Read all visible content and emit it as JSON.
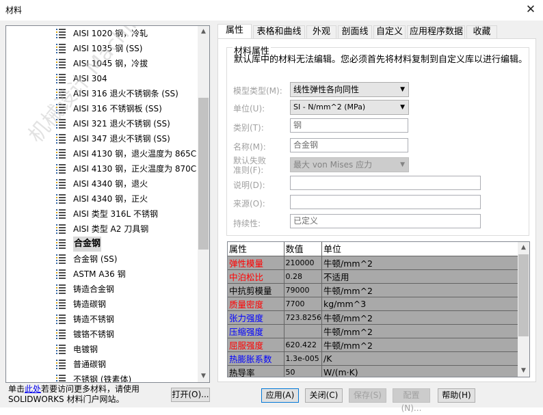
{
  "window": {
    "title": "材料",
    "close": "✕"
  },
  "watermark": "机械设计 MachineDesign",
  "tree": {
    "items": [
      {
        "label": "AISI 1020 钢，冷轧",
        "selected": false
      },
      {
        "label": "AISI 1035 钢 (SS)",
        "selected": false
      },
      {
        "label": "AISI 1045 钢，冷拔",
        "selected": false
      },
      {
        "label": "AISI 304",
        "selected": false
      },
      {
        "label": "AISI 316 退火不锈钢条 (SS)",
        "selected": false
      },
      {
        "label": "AISI 316 不锈钢板 (SS)",
        "selected": false
      },
      {
        "label": "AISI 321 退火不锈钢 (SS)",
        "selected": false
      },
      {
        "label": "AISI 347 退火不锈钢 (SS)",
        "selected": false
      },
      {
        "label": "AISI 4130 钢，退火温度为 865C",
        "selected": false
      },
      {
        "label": "AISI 4130 钢，正火温度为 870C",
        "selected": false
      },
      {
        "label": "AISI 4340 钢，退火",
        "selected": false
      },
      {
        "label": "AISI 4340 钢，正火",
        "selected": false
      },
      {
        "label": "AISI 类型 316L 不锈钢",
        "selected": false
      },
      {
        "label": "AISI 类型 A2 刀具钢",
        "selected": false
      },
      {
        "label": "合金钢",
        "selected": true
      },
      {
        "label": "合金钢 (SS)",
        "selected": false
      },
      {
        "label": "ASTM A36 钢",
        "selected": false
      },
      {
        "label": "铸造合金钢",
        "selected": false
      },
      {
        "label": "铸造碳钢",
        "selected": false
      },
      {
        "label": "铸造不锈钢",
        "selected": false
      },
      {
        "label": "镀铬不锈钢",
        "selected": false
      },
      {
        "label": "电镀钢",
        "selected": false
      },
      {
        "label": "普通碳钢",
        "selected": false
      },
      {
        "label": "不锈钢 (铁素体)",
        "selected": false
      }
    ],
    "scroll_up": "▲",
    "scroll_down": "▼"
  },
  "help": {
    "prefix": "单击",
    "link": "此处",
    "suffix": "若要访问更多材料，请使用 SOLIDWORKS 材料门户网站。"
  },
  "buttons": {
    "open": "打开(O)...",
    "apply": "应用(A)",
    "close": "关闭(C)",
    "save": "保存(S)",
    "config": "配置(N)...",
    "help": "帮助(H)"
  },
  "tabs": [
    "属性",
    "表格和曲线",
    "外观",
    "剖面线",
    "自定义",
    "应用程序数据",
    "收藏"
  ],
  "properties": {
    "group_title": "材料属性",
    "note": "默认库中的材料无法编辑。您必须首先将材料复制到自定义库以进行编辑。",
    "model_type_label": "模型类型(M):",
    "model_type_value": "线性弹性各向同性",
    "unit_label": "单位(U):",
    "unit_value": "SI - N/mm^2 (MPa)",
    "category_label": "类别(T):",
    "category_value": "钢",
    "name_label": "名称(M):",
    "name_value": "合金钢",
    "failure_label": "默认失败\n准则(F):",
    "failure_value": "最大 von Mises 应力",
    "desc_label": "说明(D):",
    "desc_value": "",
    "source_label": "来源(O):",
    "source_value": "",
    "sustain_label": "持续性:",
    "sustain_value": "已定义"
  },
  "grid": {
    "headers": [
      "属性",
      "数值",
      "单位"
    ],
    "rows": [
      {
        "name": "弹性模量",
        "value": "210000",
        "unit": "牛顿/mm^2",
        "color": "#ff0000"
      },
      {
        "name": "中泊松比",
        "value": "0.28",
        "unit": "不适用",
        "color": "#ff0000"
      },
      {
        "name": "中抗剪模量",
        "value": "79000",
        "unit": "牛顿/mm^2",
        "color": "#000000"
      },
      {
        "name": "质量密度",
        "value": "7700",
        "unit": "kg/mm^3",
        "color": "#ff0000"
      },
      {
        "name": "张力强度",
        "value": "723.8256",
        "unit": "牛顿/mm^2",
        "color": "#0000ff"
      },
      {
        "name": "压缩强度",
        "value": "",
        "unit": "牛顿/mm^2",
        "color": "#0000ff"
      },
      {
        "name": "屈服强度",
        "value": "620.422",
        "unit": "牛顿/mm^2",
        "color": "#ff0000"
      },
      {
        "name": "热膨胀系数",
        "value": "1.3e-005",
        "unit": "/K",
        "color": "#0000ff"
      },
      {
        "name": "热导率",
        "value": "50",
        "unit": "W/(m·K)",
        "color": "#000000"
      }
    ]
  }
}
